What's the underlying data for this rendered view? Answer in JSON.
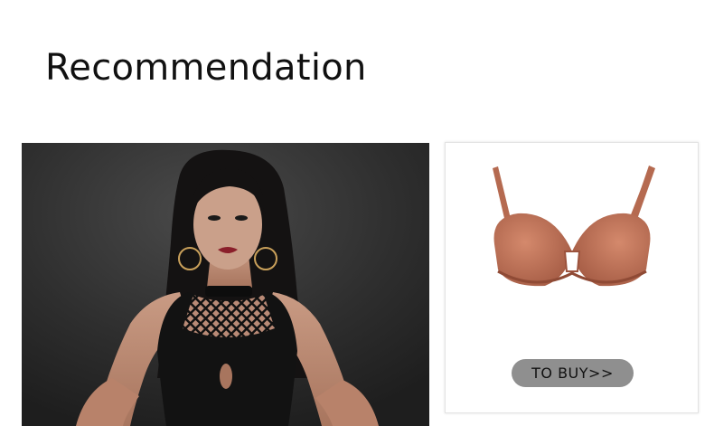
{
  "section": {
    "title": "Recommendation"
  },
  "product": {
    "buy_label": "TO BUY>>",
    "image_icon": "bra-product-image",
    "color": "#b86e55"
  },
  "model": {
    "image_icon": "model-photo"
  }
}
